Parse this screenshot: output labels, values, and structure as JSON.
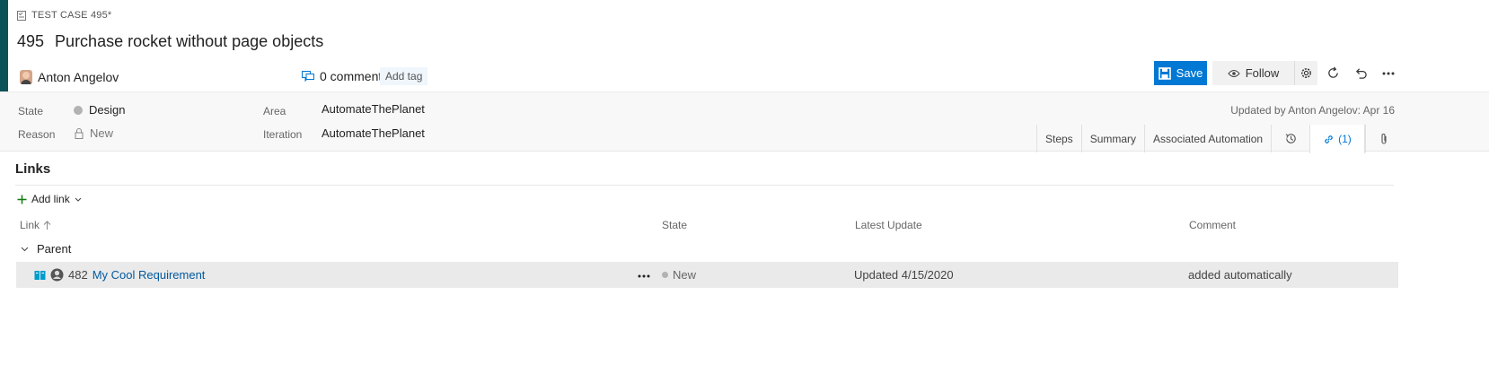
{
  "header": {
    "type_label": "TEST CASE 495*",
    "id": "495",
    "title": "Purchase rocket without page objects",
    "author": "Anton Angelov",
    "comments": "0 comments",
    "add_tag": "Add tag",
    "save": "Save",
    "follow": "Follow"
  },
  "fields": {
    "state_label": "State",
    "state_value": "Design",
    "reason_label": "Reason",
    "reason_value": "New",
    "area_label": "Area",
    "area_value": "AutomateThePlanet",
    "iteration_label": "Iteration",
    "iteration_value": "AutomateThePlanet",
    "updated": "Updated by Anton Angelov: Apr 16"
  },
  "tabs": {
    "steps": "Steps",
    "summary": "Summary",
    "associated": "Associated Automation",
    "links": "(1)"
  },
  "links": {
    "title": "Links",
    "add_link": "Add link",
    "columns": {
      "link": "Link",
      "state": "State",
      "latest": "Latest Update",
      "comment": "Comment"
    },
    "group": "Parent",
    "rows": [
      {
        "id": "482",
        "title": "My Cool Requirement",
        "state": "New",
        "latest": "Updated 4/15/2020",
        "comment": "added automatically"
      }
    ]
  },
  "colors": {
    "accent": "#0b5258",
    "primary": "#0078d4",
    "link": "#005a9e"
  },
  "icons": [
    "test-case-icon",
    "comment-icon",
    "save-icon",
    "eye-icon",
    "gear-icon",
    "refresh-icon",
    "undo-icon",
    "more-icon",
    "lock-icon",
    "history-icon",
    "link-icon",
    "attachment-icon",
    "plus-icon",
    "chevron-down-icon",
    "arrow-up-icon",
    "requirement-icon",
    "user-icon"
  ]
}
